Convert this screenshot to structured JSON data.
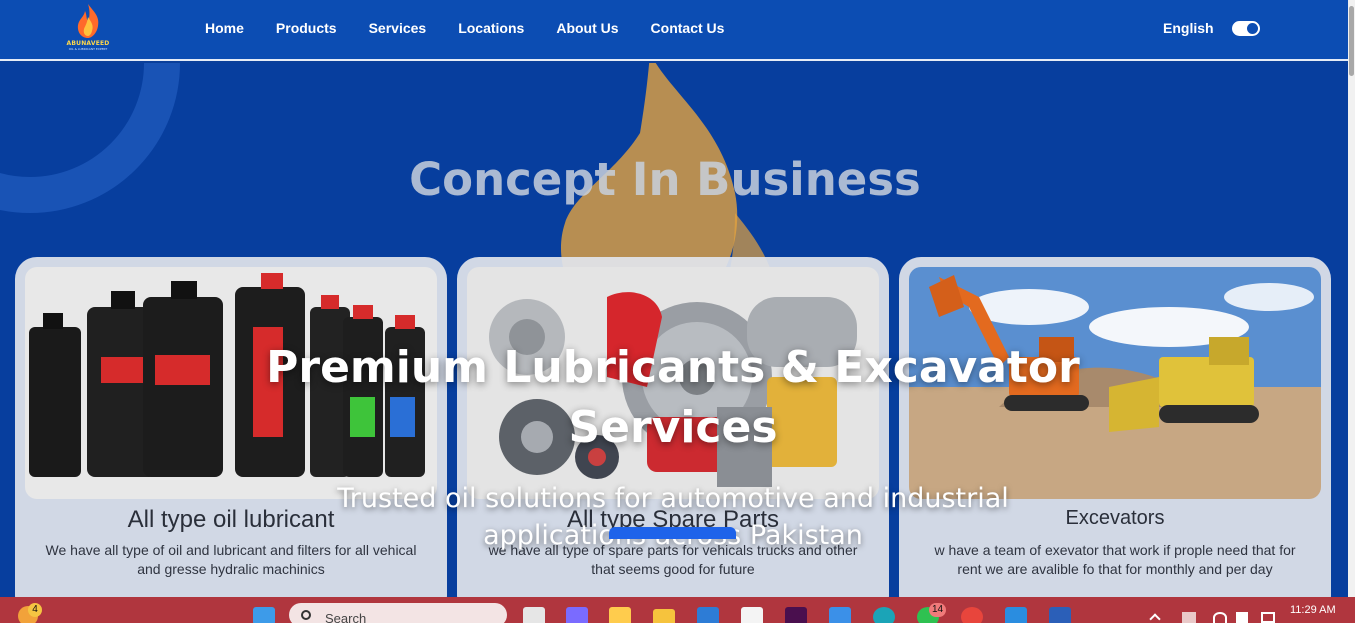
{
  "brand": {
    "name": "ABUNAVEED",
    "tagline": "OIL & LUBRICANT EXPERT"
  },
  "nav": {
    "items": [
      "Home",
      "Products",
      "Services",
      "Locations",
      "About Us",
      "Contact Us"
    ]
  },
  "language": {
    "label": "English",
    "toggle_on": true
  },
  "hero": {
    "background_heading": "Concept In Business",
    "title": "Premium Lubricants & Excavator Services",
    "subtitle": "Trusted oil solutions for automotive and industrial applications across Pakistan"
  },
  "cards": [
    {
      "title": "All type oil lubricant",
      "description": "We have all type of oil and lubricant and filters for all vehical and gresse hydralic machinics"
    },
    {
      "title": "All type Spare Parts",
      "description": "we have all type of spare parts for vehicals trucks and other that seems good for future"
    },
    {
      "title": "Excevators",
      "description": "w have a team of exevator that work if prople need that for rent we are avalible fo that  for monthly and per day"
    }
  ],
  "taskbar": {
    "search_placeholder": "Search",
    "weather_badge": "4",
    "whatsapp_badge": "14",
    "time": "11:29 AM"
  },
  "colors": {
    "nav_bg": "#0c4db3",
    "hero_bg": "#073e9e",
    "taskbar": "#b0363e",
    "cta": "#1e63ea"
  }
}
